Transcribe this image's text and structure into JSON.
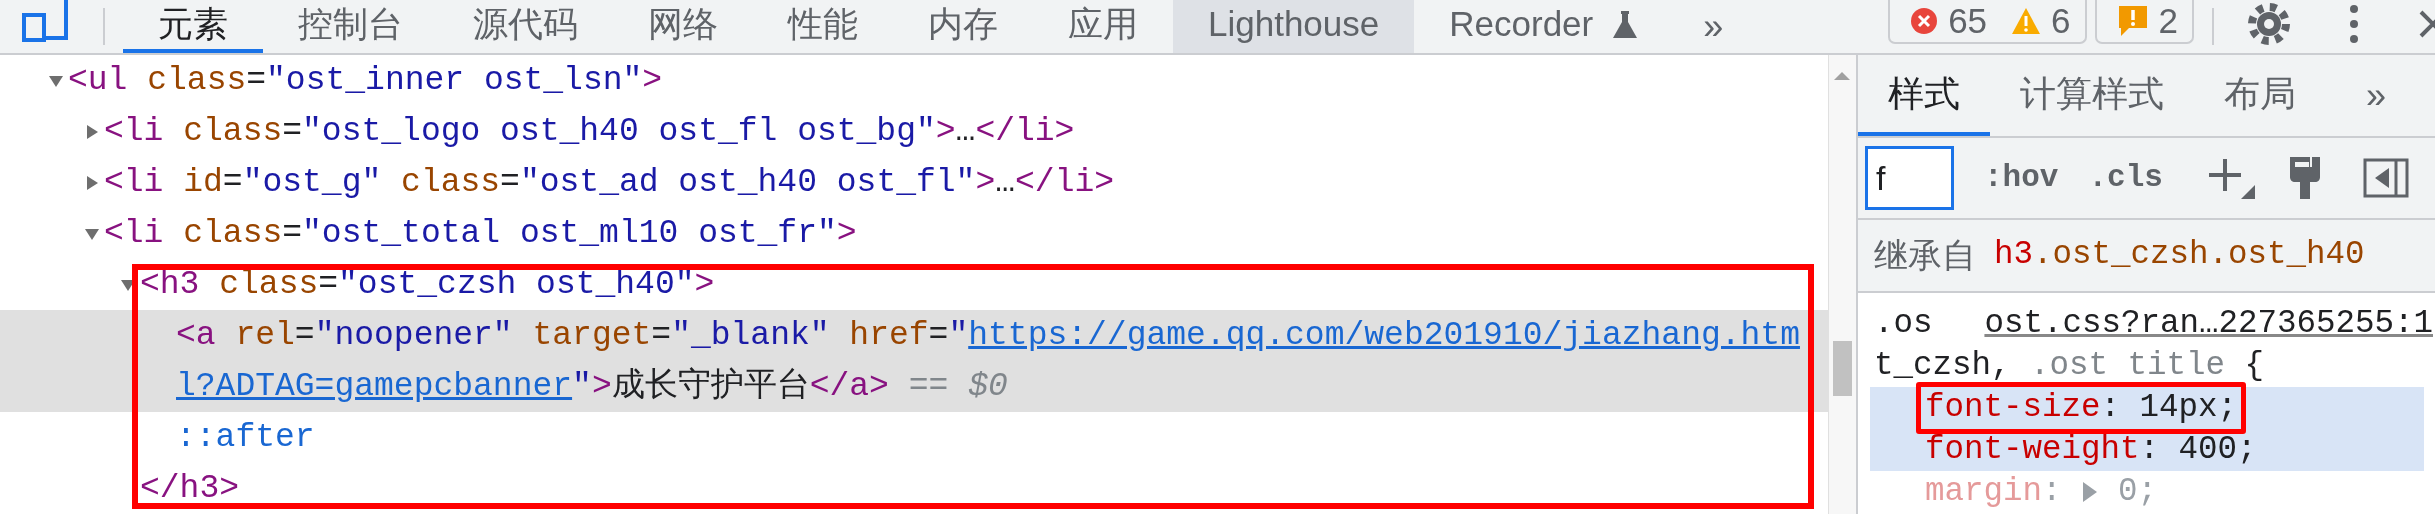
{
  "toolbar": {
    "tabs": [
      {
        "label": "元素",
        "kind": "plain",
        "selected": true,
        "hovered": false
      },
      {
        "label": "控制台",
        "kind": "plain",
        "selected": false,
        "hovered": false
      },
      {
        "label": "源代码",
        "kind": "plain",
        "selected": false,
        "hovered": false
      },
      {
        "label": "网络",
        "kind": "plain",
        "selected": false,
        "hovered": false
      },
      {
        "label": "性能",
        "kind": "plain",
        "selected": false,
        "hovered": false
      },
      {
        "label": "内存",
        "kind": "plain",
        "selected": false,
        "hovered": false
      },
      {
        "label": "应用",
        "kind": "plain",
        "selected": false,
        "hovered": false
      },
      {
        "label": "Lighthouse",
        "kind": "plain",
        "selected": false,
        "hovered": true
      },
      {
        "label": "Recorder",
        "kind": "experimental",
        "selected": false,
        "hovered": false
      }
    ],
    "overflow": "»",
    "counter_buttons": [
      {
        "items": [
          {
            "kind": "error",
            "count": "65"
          },
          {
            "kind": "warning",
            "count": "6"
          }
        ]
      },
      {
        "items": [
          {
            "kind": "issue",
            "count": "2"
          }
        ]
      }
    ]
  },
  "elements": {
    "nodes": [
      {
        "lines": [
          [
            {
              "kind": "tag",
              "text": "<ul"
            },
            {
              "kind": "attr",
              "text": " class"
            },
            {
              "kind": "eq",
              "text": "="
            },
            {
              "kind": "value",
              "text": "\"ost_inner ost_lsn\""
            },
            {
              "kind": "tag",
              "text": ">"
            }
          ]
        ],
        "expanded": true,
        "selected": false,
        "boxed": false,
        "children": [
          {
            "lines": [
              [
                {
                  "kind": "tag",
                  "text": "<li"
                },
                {
                  "kind": "attr",
                  "text": " class"
                },
                {
                  "kind": "eq",
                  "text": "="
                },
                {
                  "kind": "value",
                  "text": "\"ost_logo ost_h40 ost_fl ost_bg\""
                },
                {
                  "kind": "tag",
                  "text": ">"
                },
                {
                  "kind": "text",
                  "text": "…"
                },
                {
                  "kind": "tag",
                  "text": "</li>"
                }
              ]
            ],
            "expanded": false,
            "selected": false,
            "boxed": false
          },
          {
            "lines": [
              [
                {
                  "kind": "tag",
                  "text": "<li"
                },
                {
                  "kind": "attr",
                  "text": " id"
                },
                {
                  "kind": "eq",
                  "text": "="
                },
                {
                  "kind": "value",
                  "text": "\"ost_g\""
                },
                {
                  "kind": "attr",
                  "text": " class"
                },
                {
                  "kind": "eq",
                  "text": "="
                },
                {
                  "kind": "value",
                  "text": "\"ost_ad ost_h40 ost_fl\""
                },
                {
                  "kind": "tag",
                  "text": ">"
                },
                {
                  "kind": "text",
                  "text": "…"
                },
                {
                  "kind": "tag",
                  "text": "</li>"
                }
              ]
            ],
            "expanded": false,
            "selected": false,
            "boxed": false
          },
          {
            "lines": [
              [
                {
                  "kind": "tag",
                  "text": "<li"
                },
                {
                  "kind": "attr",
                  "text": " class"
                },
                {
                  "kind": "eq",
                  "text": "="
                },
                {
                  "kind": "value",
                  "text": "\"ost_total ost_ml10 ost_fr\""
                },
                {
                  "kind": "tag",
                  "text": ">"
                }
              ]
            ],
            "expanded": true,
            "selected": false,
            "boxed": false,
            "children": [
              {
                "lines": [
                  [
                    {
                      "kind": "tag",
                      "text": "<h3"
                    },
                    {
                      "kind": "attr",
                      "text": " class"
                    },
                    {
                      "kind": "eq",
                      "text": "="
                    },
                    {
                      "kind": "value",
                      "text": "\"ost_czsh ost_h40\""
                    },
                    {
                      "kind": "tag",
                      "text": ">"
                    }
                  ]
                ],
                "expanded": true,
                "selected": false,
                "boxed": true,
                "closing": [
                  {
                    "kind": "tag",
                    "text": "</h3>"
                  }
                ],
                "children": [
                  {
                    "lines": [
                      [
                        {
                          "kind": "tag",
                          "text": "<a"
                        },
                        {
                          "kind": "attr",
                          "text": " rel"
                        },
                        {
                          "kind": "eq",
                          "text": "="
                        },
                        {
                          "kind": "value",
                          "text": "\"noopener\""
                        },
                        {
                          "kind": "attr",
                          "text": " target"
                        },
                        {
                          "kind": "eq",
                          "text": "="
                        },
                        {
                          "kind": "value",
                          "text": "\"_blank\""
                        },
                        {
                          "kind": "attr",
                          "text": " href"
                        },
                        {
                          "kind": "eq",
                          "text": "="
                        },
                        {
                          "kind": "value",
                          "text": "\""
                        },
                        {
                          "kind": "link",
                          "text": "https://game.qq.com/web201910/jiazhang.htm"
                        }
                      ],
                      [
                        {
                          "kind": "link",
                          "text": "l?ADTAG=gamepcbanner"
                        },
                        {
                          "kind": "value",
                          "text": "\""
                        },
                        {
                          "kind": "tag",
                          "text": ">"
                        },
                        {
                          "kind": "text",
                          "text": "成长守护平台"
                        },
                        {
                          "kind": "tag",
                          "text": "</a>"
                        },
                        {
                          "kind": "hint",
                          "text": " == $0"
                        }
                      ]
                    ],
                    "selected": true,
                    "boxed": false
                  },
                  {
                    "lines": [
                      [
                        {
                          "kind": "pseudo",
                          "text": "::after"
                        }
                      ]
                    ],
                    "selected": false,
                    "boxed": false
                  }
                ]
              }
            ]
          }
        ]
      }
    ]
  },
  "styles": {
    "tabs": [
      {
        "label": "样式",
        "selected": true
      },
      {
        "label": "计算样式",
        "selected": false
      },
      {
        "label": "布局",
        "selected": false
      }
    ],
    "overflow": "»",
    "filter": {
      "value": "f"
    },
    "toggles": [
      ":hov",
      ".cls"
    ],
    "inherited": {
      "label": "继承自",
      "selector": [
        {
          "kind": "tag",
          "text": "h3"
        },
        {
          "kind": "class",
          "text": ".ost_czsh.ost_h40"
        }
      ]
    },
    "rule": {
      "selector_lines": [
        [
          {
            "kind": "match",
            "text": ".os"
          }
        ],
        [
          {
            "kind": "match",
            "text": "t_czsh,"
          },
          {
            "kind": "nomatch",
            "text": " .ost title"
          },
          {
            "kind": "match",
            "text": " {"
          }
        ]
      ],
      "source": "ost.css?ran…227365255:1",
      "declarations": [
        {
          "name": "font-size",
          "colon": ":",
          "value": " 14px;",
          "expandable": false,
          "highlighted": true,
          "boxed": true,
          "inactive": false
        },
        {
          "name": "font-weight",
          "colon": ":",
          "value": " 400;",
          "expandable": false,
          "highlighted": true,
          "boxed": false,
          "inactive": false
        },
        {
          "name": "margin",
          "colon": ":",
          "value": " 0;",
          "expandable": true,
          "highlighted": false,
          "boxed": false,
          "inactive": true
        }
      ]
    }
  }
}
